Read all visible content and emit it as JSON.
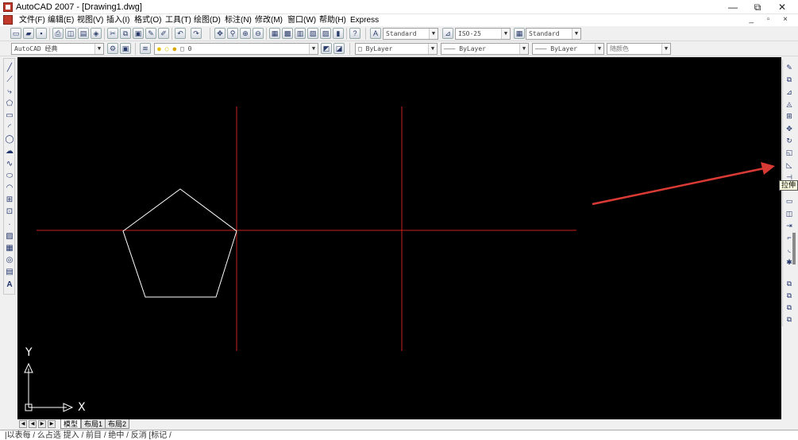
{
  "window": {
    "title": "AutoCAD 2007 - [Drawing1.dwg]",
    "minimize": "—",
    "maximize": "⧉",
    "close": "✕"
  },
  "menu": {
    "items": [
      "文件(F)",
      "编辑(E)",
      "视图(V)",
      "插入(I)",
      "格式(O)",
      "工具(T)",
      "绘图(D)",
      "标注(N)",
      "修改(M)",
      "窗口(W)",
      "帮助(H)",
      "Express"
    ],
    "mdi_buttons": "_ ▫ ×"
  },
  "toolbar": {
    "text_style": "Standard",
    "dim_style": "ISO-25",
    "table_style": "Standard",
    "workspace": "AutoCAD 经典",
    "layer": "0",
    "color": "ByLayer",
    "linetype": "ByLayer",
    "lineweight": "ByLayer",
    "plot_style": "随颜色"
  },
  "tooltip": {
    "text": "拉伸"
  },
  "layout_tabs": [
    "模型",
    "布局1",
    "布局2"
  ],
  "ucs": {
    "x_label": "X",
    "y_label": "Y"
  },
  "command_line": "|以表每 / 么占选   提入 / 前目 / 绝中 / 反消   [标记 /",
  "colors": {
    "canvas_bg": "#000000",
    "pentagon_stroke": "#ffffff",
    "construction_line": "#cc1f1f",
    "annotation_arrow": "#d93a34",
    "ucs_icon": "#ffffff"
  },
  "icons": {
    "draw_tools": [
      "line-icon",
      "construction-line-icon",
      "polyline-icon",
      "polygon-icon",
      "rectangle-icon",
      "arc-icon",
      "circle-icon",
      "revision-cloud-icon",
      "spline-icon",
      "ellipse-icon",
      "ellipse-arc-icon",
      "insert-block-icon",
      "make-block-icon",
      "point-icon",
      "hatch-icon",
      "gradient-icon",
      "region-icon",
      "table-icon",
      "multiline-text-icon"
    ],
    "modify_tools": [
      "erase-icon",
      "copy-icon",
      "mirror-icon",
      "offset-icon",
      "array-icon",
      "move-icon",
      "rotate-icon",
      "scale-icon",
      "stretch-icon",
      "trim-icon",
      "extend-icon",
      "break-at-point-icon",
      "break-icon",
      "join-icon",
      "chamfer-icon",
      "fillet-icon",
      "explode-icon",
      "draworder-icon"
    ]
  }
}
